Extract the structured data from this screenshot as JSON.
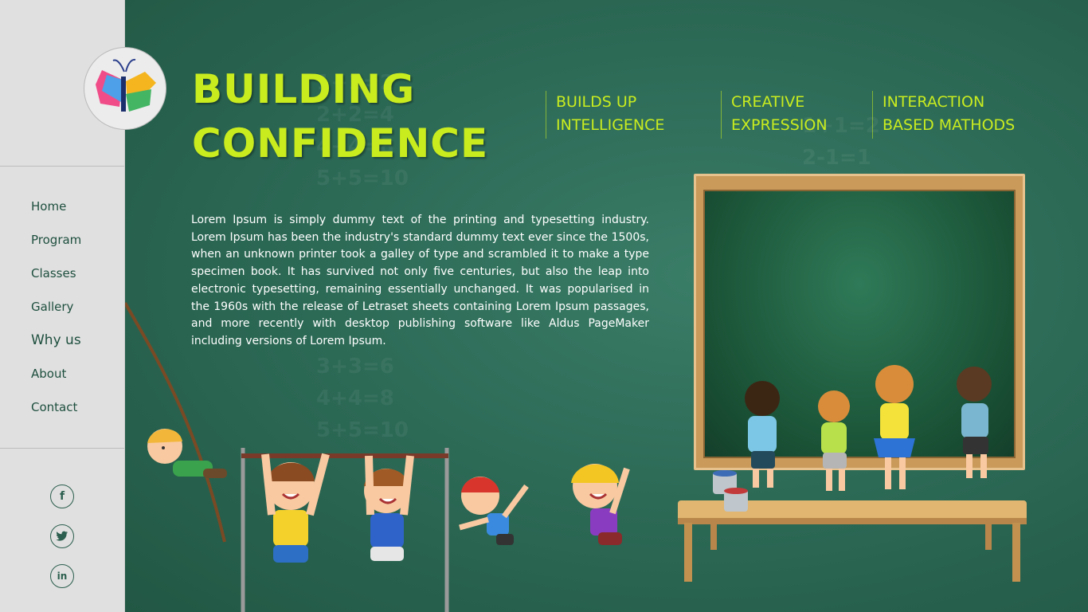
{
  "nav": {
    "items": [
      {
        "label": "Home"
      },
      {
        "label": "Program"
      },
      {
        "label": "Classes"
      },
      {
        "label": "Gallery"
      },
      {
        "label": "Why us"
      },
      {
        "label": "About"
      },
      {
        "label": "Contact"
      }
    ]
  },
  "social": {
    "facebook": "f",
    "twitter": "t",
    "linkedin": "in"
  },
  "hero": {
    "title_line1": "BUILDING",
    "title_line2": "CONFIDENCE",
    "body": "Lorem Ipsum is simply dummy text of the printing and typesetting industry. Lorem Ipsum has been the industry's standard dummy text ever since the 1500s, when an unknown printer took a galley of type and scrambled it to make a type specimen book. It has survived not only five centuries, but also the leap into electronic typesetting, remaining essentially unchanged. It was popularised in the 1960s with the release of Letraset sheets containing Lorem Ipsum passages, and more recently with desktop publishing software like Aldus PageMaker including versions of Lorem Ipsum."
  },
  "features": [
    {
      "line1": "BUILDS UP",
      "line2": "INTELLIGENCE"
    },
    {
      "line1": "CREATIVE",
      "line2": "EXPRESSION"
    },
    {
      "line1": "INTERACTION",
      "line2": "BASED MATHODS"
    }
  ],
  "background_chalk": {
    "block1": "1+1=2\n2+2=4\n4+4=8\n5+5=10",
    "block2": "3+3=6\n4+4=8\n5+5=10",
    "block3": "1+1=2\n2-1=1"
  },
  "colors": {
    "accent": "#c9ec1f",
    "background": "#2d6b57",
    "sidebar": "#e0e0e0",
    "nav_text": "#1e4f3e"
  },
  "icons": {
    "logo": "butterfly-book-icon",
    "social": [
      "facebook-icon",
      "twitter-icon",
      "linkedin-icon"
    ]
  }
}
